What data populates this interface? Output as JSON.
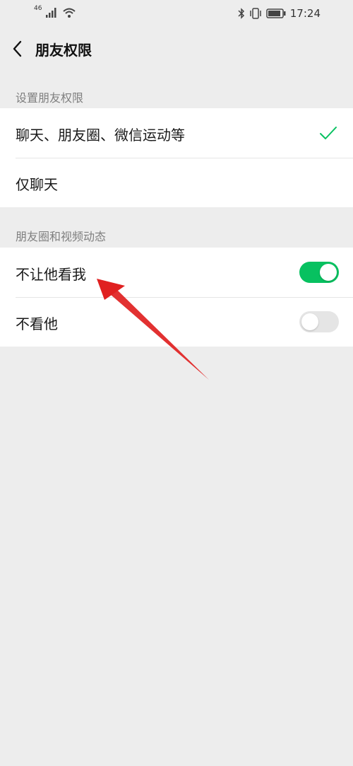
{
  "status_bar": {
    "network": "46",
    "time": "17:24",
    "icons": [
      "signal-icon",
      "wifi-icon",
      "bluetooth-icon",
      "vibrate-icon",
      "battery-icon"
    ]
  },
  "nav": {
    "title": "朋友权限",
    "back_icon": "back-arrow-icon"
  },
  "sections": [
    {
      "label": "设置朋友权限",
      "rows": [
        {
          "label": "聊天、朋友圈、微信运动等",
          "selected": true
        },
        {
          "label": "仅聊天",
          "selected": false
        }
      ]
    },
    {
      "label": "朋友圈和视频动态",
      "rows": [
        {
          "label": "不让他看我",
          "toggle": true
        },
        {
          "label": "不看他",
          "toggle": false
        }
      ]
    }
  ],
  "colors": {
    "accent": "#07c160",
    "toggle_off": "#e5e5e5",
    "annotation_arrow": "#e02020",
    "background": "#ededed"
  }
}
